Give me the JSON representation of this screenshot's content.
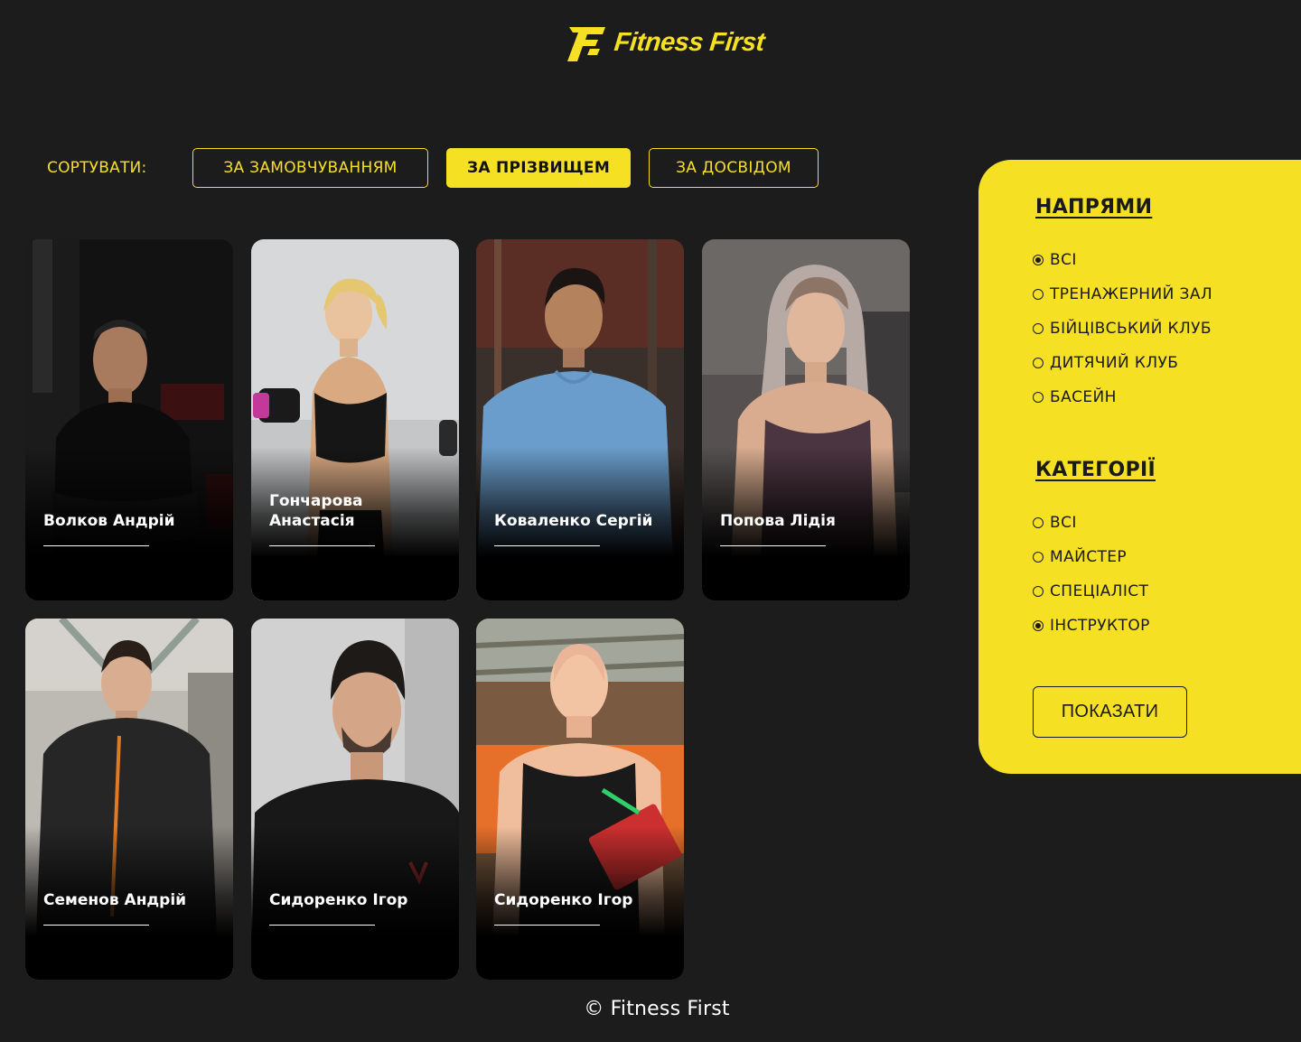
{
  "brand": {
    "logo_text": "Fitness First",
    "accent_color": "#f6e024",
    "background_color": "#1c1c1c"
  },
  "sort": {
    "label": "СОРТУВАТИ:",
    "options": [
      {
        "label": "ЗА ЗАМОВЧУВАННЯМ",
        "active": false
      },
      {
        "label": "ЗА ПРІЗВИЩЕМ",
        "active": true
      },
      {
        "label": "ЗА ДОСВІДОМ",
        "active": false
      }
    ]
  },
  "trainers": [
    {
      "name": "Волков Андрій"
    },
    {
      "name": "Гончарова Анастасія"
    },
    {
      "name": "Коваленко Сергій"
    },
    {
      "name": "Попова Лідія"
    },
    {
      "name": "Семенов Андрій"
    },
    {
      "name": "Сидоренко Ігор"
    },
    {
      "name": "Сидоренко Ігор"
    }
  ],
  "filters": {
    "directions": {
      "title": "НАПРЯМИ",
      "options": [
        {
          "label": "ВСІ",
          "checked": true
        },
        {
          "label": "ТРЕНАЖЕРНИЙ ЗАЛ",
          "checked": false
        },
        {
          "label": "БІЙЦІВСЬКИЙ КЛУБ",
          "checked": false
        },
        {
          "label": "ДИТЯЧИЙ КЛУБ",
          "checked": false
        },
        {
          "label": "БАСЕЙН",
          "checked": false
        }
      ]
    },
    "categories": {
      "title": "КАТЕГОРІЇ",
      "options": [
        {
          "label": "ВСІ",
          "checked": false
        },
        {
          "label": "МАЙСТЕР",
          "checked": false
        },
        {
          "label": "СПЕЦІАЛІСТ",
          "checked": false
        },
        {
          "label": "ІНСТРУКТОР",
          "checked": true
        }
      ]
    },
    "submit_label": "ПОКАЗАТИ"
  },
  "footer": {
    "text": "© Fitness First"
  }
}
